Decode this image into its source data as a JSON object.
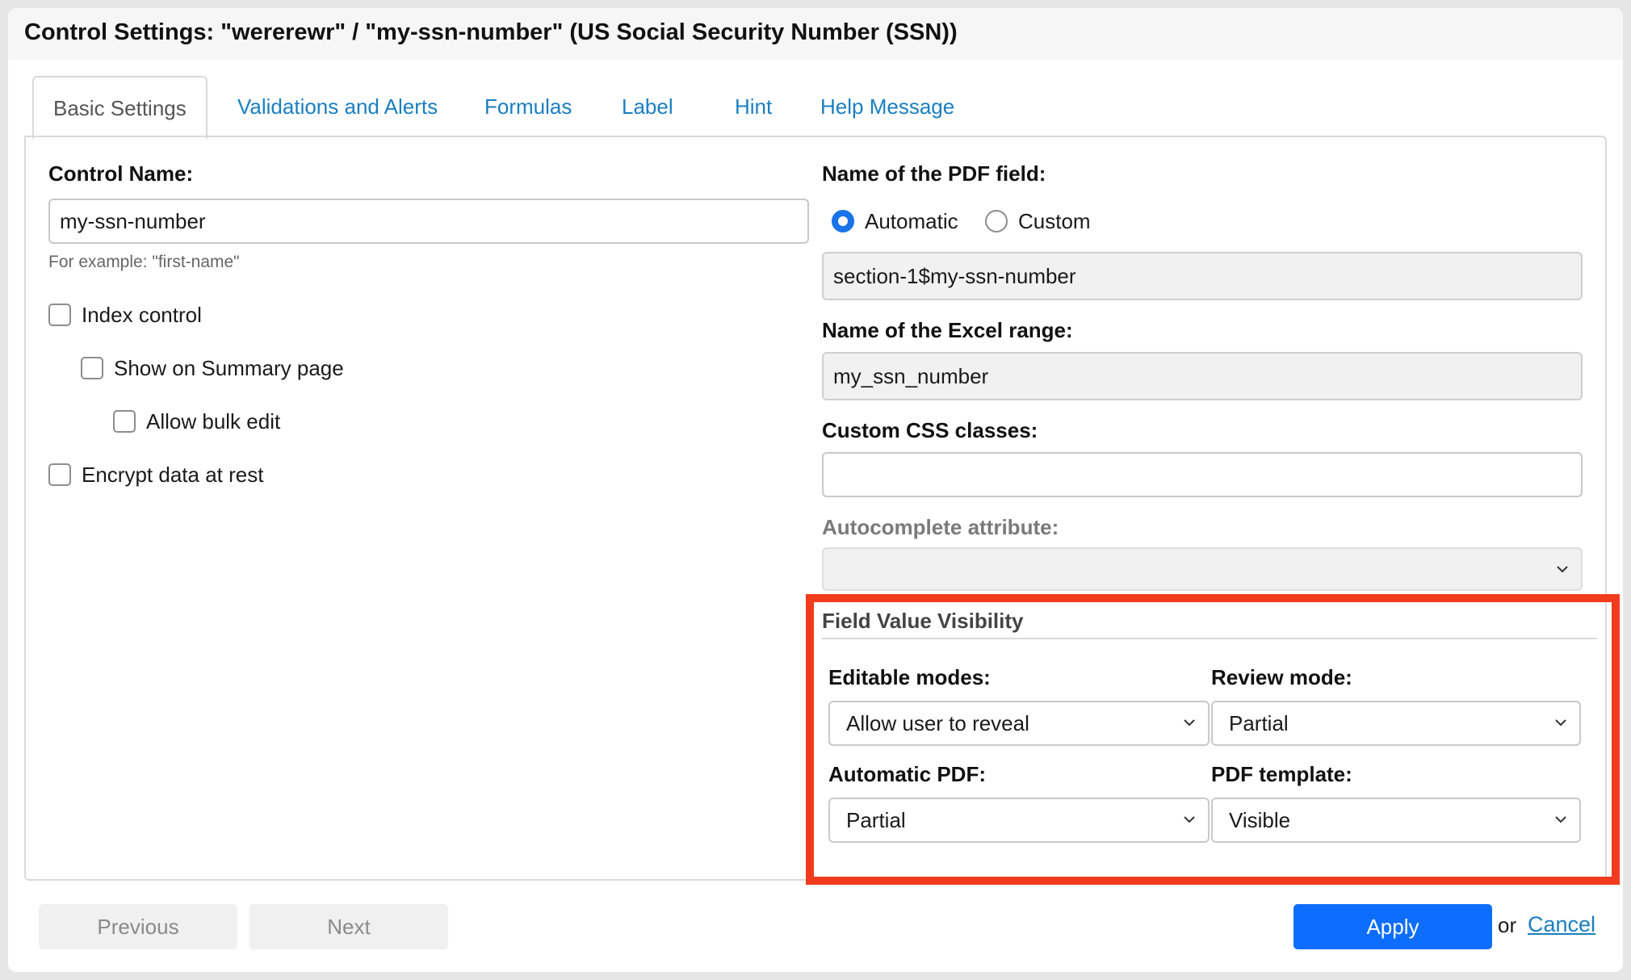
{
  "dialog": {
    "title": "Control Settings: \"wererewr\" / \"my-ssn-number\" (US Social Security Number (SSN))"
  },
  "tabs": [
    {
      "label": "Basic Settings",
      "active": true
    },
    {
      "label": "Validations and Alerts",
      "active": false
    },
    {
      "label": "Formulas",
      "active": false
    },
    {
      "label": "Label",
      "active": false
    },
    {
      "label": "Hint",
      "active": false
    },
    {
      "label": "Help Message",
      "active": false
    }
  ],
  "left": {
    "control_name_label": "Control Name:",
    "control_name_value": "my-ssn-number",
    "control_name_hint": "For example: \"first-name\"",
    "checkboxes": [
      {
        "label": "Index control",
        "checked": false
      },
      {
        "label": "Show on Summary page",
        "checked": false
      },
      {
        "label": "Allow bulk edit",
        "checked": false
      },
      {
        "label": "Encrypt data at rest",
        "checked": false
      }
    ]
  },
  "right": {
    "pdf_field_label": "Name of the PDF field:",
    "pdf_radio_automatic": "Automatic",
    "pdf_radio_custom": "Custom",
    "pdf_selected": "Automatic",
    "pdf_field_value": "section-1$my-ssn-number",
    "excel_range_label": "Name of the Excel range:",
    "excel_range_value": "my_ssn_number",
    "css_classes_label": "Custom CSS classes:",
    "css_classes_value": "",
    "autocomplete_label": "Autocomplete attribute:",
    "autocomplete_value": ""
  },
  "visibility": {
    "title": "Field Value Visibility",
    "editable_modes_label": "Editable modes:",
    "editable_modes_value": "Allow user to reveal",
    "review_mode_label": "Review mode:",
    "review_mode_value": "Partial",
    "automatic_pdf_label": "Automatic PDF:",
    "automatic_pdf_value": "Partial",
    "pdf_template_label": "PDF template:",
    "pdf_template_value": "Visible",
    "highlight_color": "#f23a1d"
  },
  "footer": {
    "previous_label": "Previous",
    "next_label": "Next",
    "apply_label": "Apply",
    "or_text": "or",
    "cancel_label": "Cancel"
  },
  "colors": {
    "accent": "#0d6efd",
    "link": "#1a7fc0",
    "radio_checked": "#1a73e8"
  },
  "icons": {
    "select_arrow": "chevron-down-icon"
  }
}
